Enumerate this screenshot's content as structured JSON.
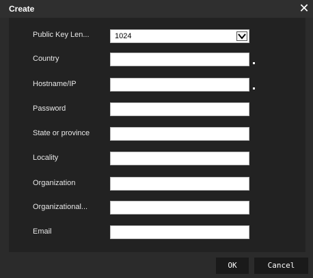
{
  "dialog": {
    "title": "Create",
    "close_icon": "close-icon"
  },
  "form": {
    "fields": [
      {
        "label": "Public Key Len...",
        "type": "select",
        "value": "1024",
        "required": false
      },
      {
        "label": "Country",
        "type": "text",
        "value": "",
        "required": true
      },
      {
        "label": "Hostname/IP",
        "type": "text",
        "value": "",
        "required": true
      },
      {
        "label": "Password",
        "type": "text",
        "value": "",
        "required": false
      },
      {
        "label": "State or province",
        "type": "text",
        "value": "",
        "required": false
      },
      {
        "label": "Locality",
        "type": "text",
        "value": "",
        "required": false
      },
      {
        "label": "Organization",
        "type": "text",
        "value": "",
        "required": false
      },
      {
        "label": "Organizational...",
        "type": "text",
        "value": "",
        "required": false
      },
      {
        "label": "Email",
        "type": "text",
        "value": "",
        "required": false
      }
    ]
  },
  "buttons": {
    "ok_label": "OK",
    "cancel_label": "Cancel"
  },
  "colors": {
    "dialog_bg": "#2b2b2b",
    "panel_bg": "#222222",
    "button_bg": "#1a1a1a",
    "text": "#ffffff"
  }
}
